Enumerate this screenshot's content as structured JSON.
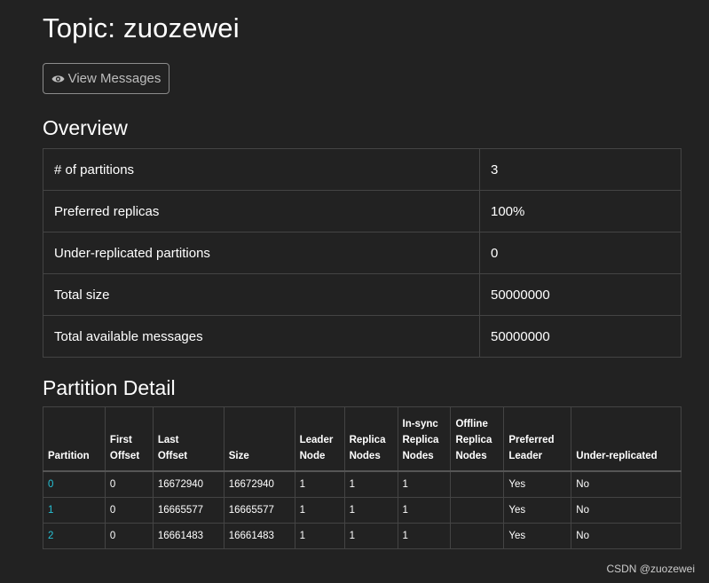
{
  "page": {
    "title": "Topic: zuozewei",
    "view_messages_label": "View Messages"
  },
  "overview": {
    "heading": "Overview",
    "rows": [
      {
        "label": "# of partitions",
        "value": "3"
      },
      {
        "label": "Preferred replicas",
        "value": "100%"
      },
      {
        "label": "Under-replicated partitions",
        "value": "0"
      },
      {
        "label": "Total size",
        "value": "50000000"
      },
      {
        "label": "Total available messages",
        "value": "50000000"
      }
    ]
  },
  "partition_detail": {
    "heading": "Partition Detail",
    "columns": [
      [
        "Partition"
      ],
      [
        "First",
        "Offset"
      ],
      [
        "Last",
        "Offset"
      ],
      [
        "Size"
      ],
      [
        "Leader",
        "Node"
      ],
      [
        "Replica",
        "Nodes"
      ],
      [
        "In-sync",
        "Replica",
        "Nodes"
      ],
      [
        "Offline",
        "Replica",
        "Nodes"
      ],
      [
        "Preferred",
        "Leader"
      ],
      [
        "Under-replicated"
      ]
    ],
    "rows": [
      [
        "0",
        "0",
        "16672940",
        "16672940",
        "1",
        "1",
        "1",
        "",
        "Yes",
        "No"
      ],
      [
        "1",
        "0",
        "16665577",
        "16665577",
        "1",
        "1",
        "1",
        "",
        "Yes",
        "No"
      ],
      [
        "2",
        "0",
        "16661483",
        "16661483",
        "1",
        "1",
        "1",
        "",
        "Yes",
        "No"
      ]
    ]
  },
  "watermark": "CSDN @zuozewei",
  "colors": {
    "background": "#222222",
    "link": "#27c2d6",
    "border": "#444444"
  }
}
